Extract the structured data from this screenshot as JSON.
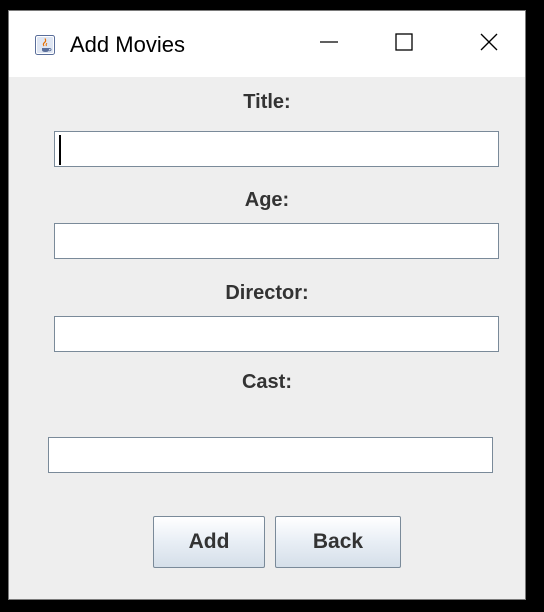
{
  "window": {
    "title": "Add Movies",
    "app_icon": "java-icon",
    "controls": {
      "minimize_icon": "minimize-icon",
      "maximize_icon": "maximize-icon",
      "close_icon": "close-icon"
    }
  },
  "form": {
    "title_label": "Title:",
    "title_value": "",
    "age_label": "Age:",
    "age_value": "",
    "director_label": "Director:",
    "director_value": "",
    "cast_label": "Cast:",
    "cast_value": ""
  },
  "buttons": {
    "add_label": "Add",
    "back_label": "Back"
  },
  "colors": {
    "window_bg": "#eeeeee",
    "titlebar_bg": "#ffffff",
    "label_text": "#333333",
    "field_border": "#7a8a99"
  }
}
